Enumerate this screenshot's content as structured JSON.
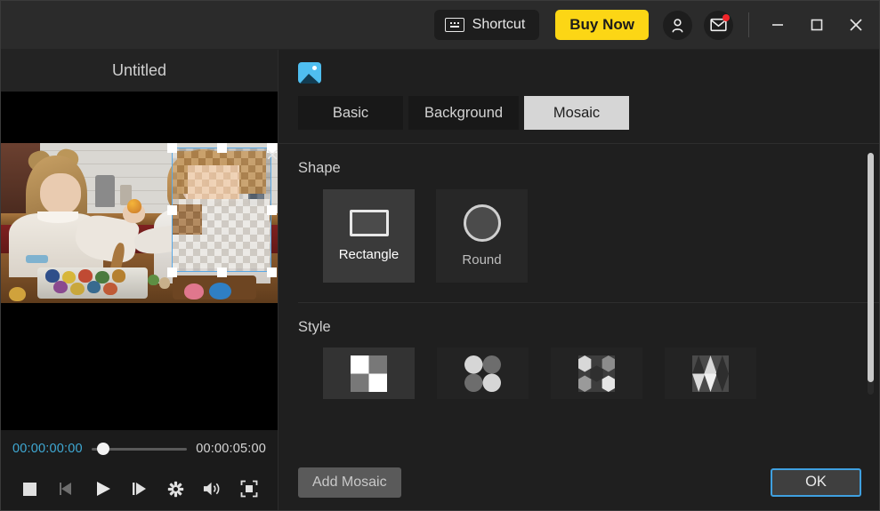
{
  "titlebar": {
    "shortcut_label": "Shortcut",
    "shortcut_icon": "keyboard-icon",
    "buy_label": "Buy Now",
    "buy_color": "#fcd615",
    "account_icon": "person-icon",
    "mail_icon": "envelope-icon",
    "notification_color": "#f2252a",
    "minimize_label": "–",
    "maximize_icon": "square-icon",
    "close_label": "×"
  },
  "preview": {
    "title": "Untitled",
    "timecode_start": "00:00:00:00",
    "timecode_end": "00:00:05:00",
    "timecode_start_color": "#3fa9d4",
    "seek_position_pct": 8,
    "transport": [
      {
        "name": "stop-button",
        "icon": "stop-icon"
      },
      {
        "name": "previous-frame-button",
        "icon": "previous-frame-icon"
      },
      {
        "name": "play-button",
        "icon": "play-icon"
      },
      {
        "name": "next-frame-button",
        "icon": "next-frame-icon"
      },
      {
        "name": "settings-button",
        "icon": "gear-icon"
      },
      {
        "name": "volume-button",
        "icon": "speaker-icon"
      },
      {
        "name": "fullscreen-button",
        "icon": "fullscreen-icon"
      }
    ]
  },
  "panel": {
    "header_icon": "image-icon",
    "tabs": [
      {
        "label": "Basic",
        "active": false
      },
      {
        "label": "Background",
        "active": false
      },
      {
        "label": "Mosaic",
        "active": true
      }
    ],
    "shape_section": {
      "label": "Shape",
      "options": [
        {
          "label": "Rectangle",
          "icon": "rectangle-icon",
          "selected": true
        },
        {
          "label": "Round",
          "icon": "circle-icon",
          "selected": false
        }
      ]
    },
    "style_section": {
      "label": "Style",
      "options": [
        {
          "name": "style-checkerboard",
          "pattern": "squares",
          "selected": true
        },
        {
          "name": "style-circles",
          "pattern": "circles",
          "selected": false
        },
        {
          "name": "style-hexagons",
          "pattern": "hexagons",
          "selected": false
        },
        {
          "name": "style-triangles",
          "pattern": "triangles",
          "selected": false
        }
      ]
    }
  },
  "footer": {
    "add_label": "Add Mosaic",
    "ok_label": "OK",
    "ok_border_color": "#3fa0e0"
  }
}
